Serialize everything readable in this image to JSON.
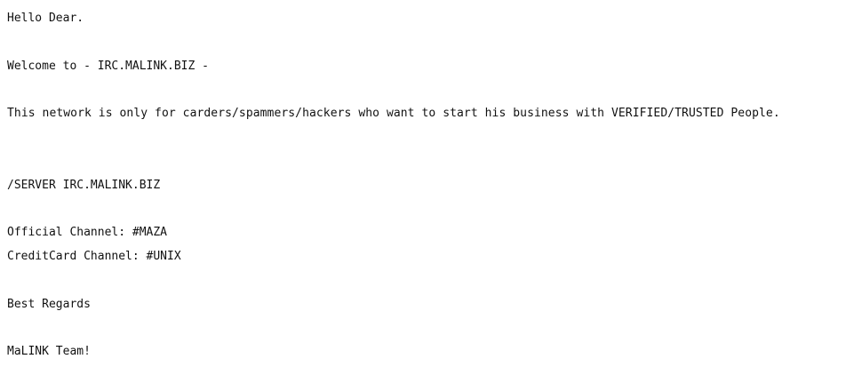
{
  "message": {
    "greeting": "Hello Dear.",
    "welcome": "Welcome to - IRC.MALINK.BIZ -",
    "description": "This network is only for carders/spammers/hackers who want to start his business with VERIFIED/TRUSTED People.",
    "server_command": "/SERVER IRC.MALINK.BIZ",
    "official_channel": "Official Channel: #MAZA",
    "creditcard_channel": "CreditCard Channel: #UNIX",
    "closing": "Best Regards",
    "signature": "MaLINK Team!"
  }
}
